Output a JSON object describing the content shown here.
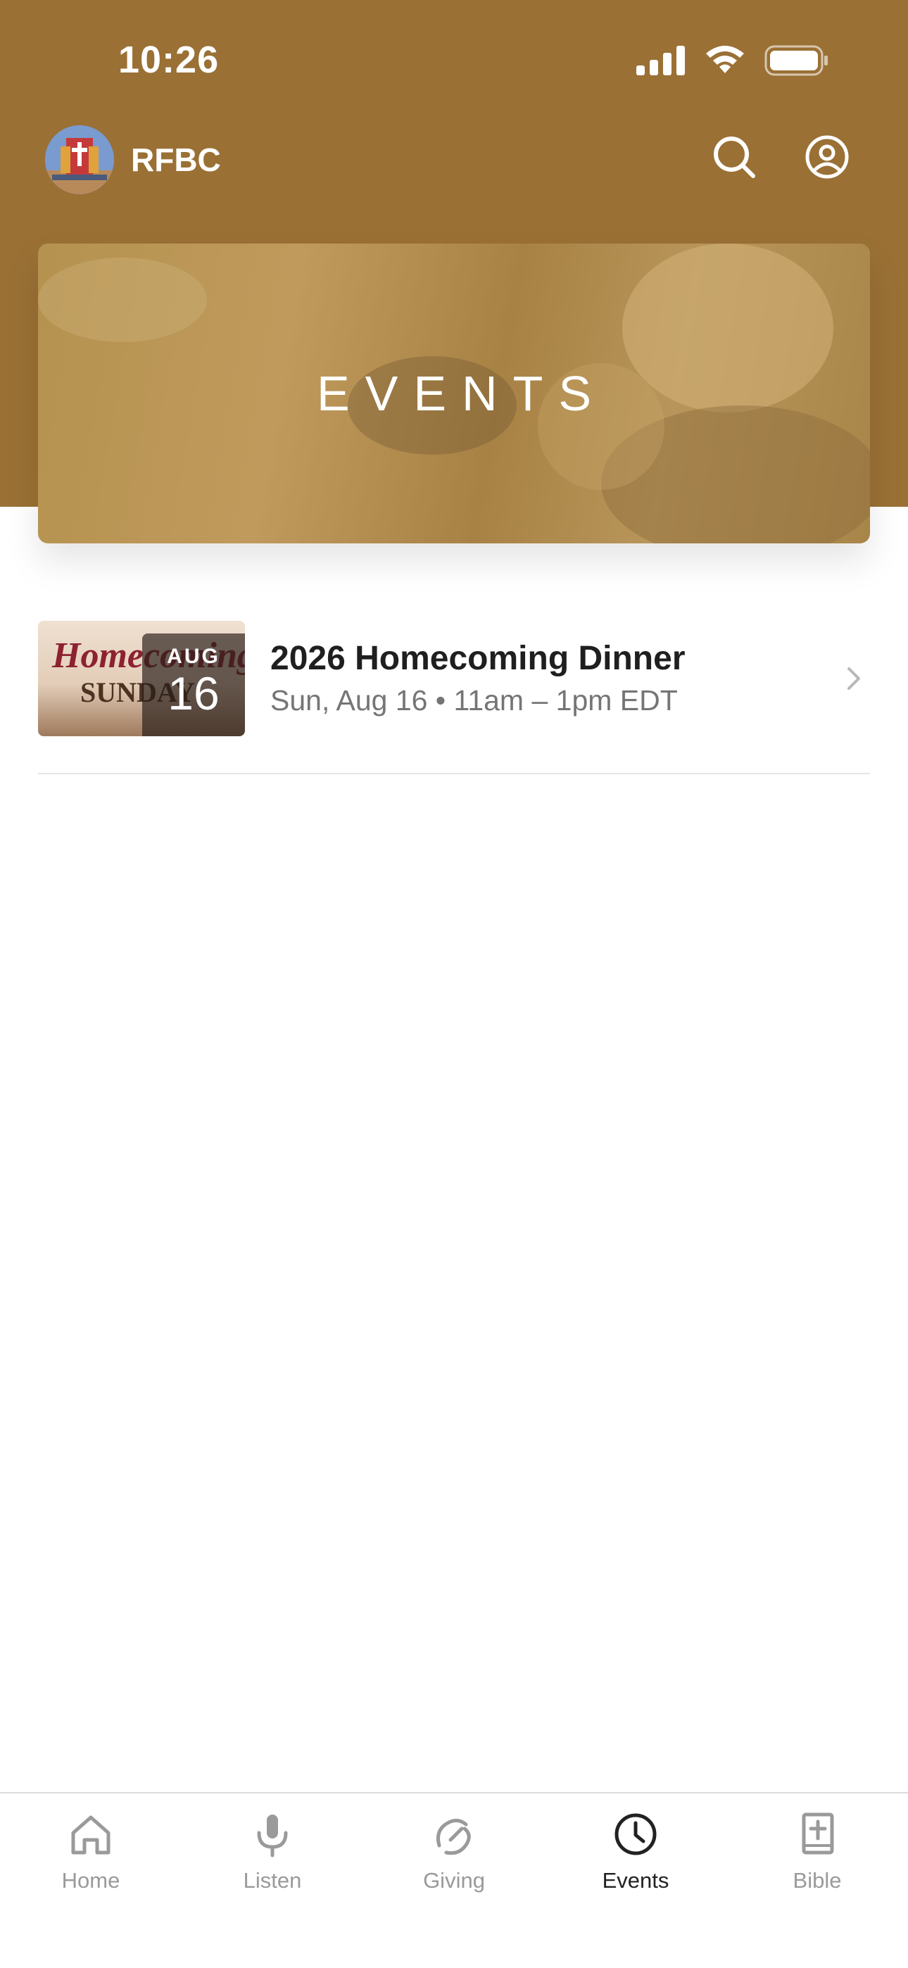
{
  "status_bar": {
    "time": "10:26"
  },
  "header": {
    "app_name": "RFBC"
  },
  "hero": {
    "title": "EVENTS"
  },
  "events": [
    {
      "title": "2026 Homecoming Dinner",
      "meta": "Sun, Aug 16 • 11am – 1pm EDT",
      "badge_month": "AUG",
      "badge_day": "16",
      "thumb_line1": "Homecoming",
      "thumb_line2": "SUNDAY"
    }
  ],
  "tab_bar": {
    "tabs": [
      {
        "label": "Home",
        "icon": "home-icon"
      },
      {
        "label": "Listen",
        "icon": "microphone-icon"
      },
      {
        "label": "Giving",
        "icon": "giving-icon"
      },
      {
        "label": "Events",
        "icon": "clock-icon",
        "active": true
      },
      {
        "label": "Bible",
        "icon": "bible-icon"
      }
    ]
  },
  "colors": {
    "header_brown": "#9a7035",
    "active_tab": "#222222",
    "inactive_tab": "#9a9a9a"
  }
}
